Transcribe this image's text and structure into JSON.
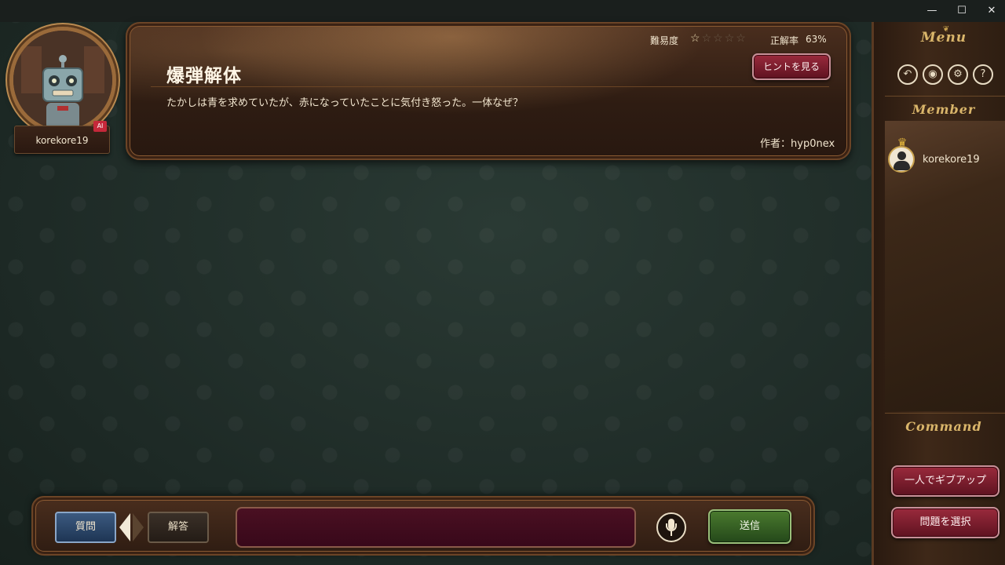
{
  "window": {
    "minimize": "—",
    "maximize": "☐",
    "close": "✕"
  },
  "player": {
    "name": "korekore19",
    "badge": "AI"
  },
  "question": {
    "difficulty_label": "難易度",
    "difficulty_stars": 1,
    "difficulty_max": 5,
    "correct_rate_label": "正解率",
    "correct_rate": "63%",
    "hint_button": "ヒントを見る",
    "title": "爆弾解体",
    "body": "たかしは青を求めていたが、赤になっていたことに気付き怒った。一体なぜ？",
    "author_label": "作者：",
    "author_name": "hyp0nex"
  },
  "sidebar": {
    "menu_title": "Menu",
    "ornament": "❦",
    "menu_icons": [
      {
        "icon": "back-icon",
        "glyph": "↶"
      },
      {
        "icon": "discord-icon",
        "glyph": "◉"
      },
      {
        "icon": "settings-icon",
        "glyph": "⚙"
      },
      {
        "icon": "help-icon",
        "glyph": "?"
      }
    ],
    "member_title": "Member",
    "members": [
      {
        "name": "korekore19",
        "crown": "♛",
        "is_host": true
      }
    ],
    "command_title": "Command",
    "commands": [
      "一人でギブアップ",
      "問題を選択"
    ]
  },
  "input_bar": {
    "mode_question": "質問",
    "mode_answer": "解答",
    "active_mode": "question",
    "text_value": "",
    "text_placeholder": "",
    "send_button": "送信"
  },
  "colors": {
    "background": "#1f2c27",
    "panel_wood": "#3a2418",
    "accent_gold": "#d9b56a",
    "button_red": "#7a1c2c",
    "button_blue": "#2c4a6e",
    "button_green": "#3a6424"
  }
}
